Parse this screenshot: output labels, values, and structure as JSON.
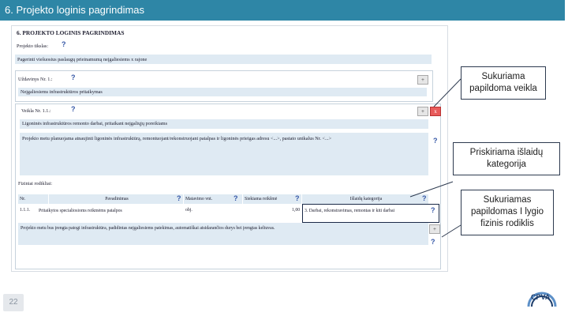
{
  "slide": {
    "title": "6. Projekto loginis pagrindimas",
    "page_number": "22"
  },
  "form": {
    "title": "6. PROJEKTO LOGINIS PAGRINDIMAS",
    "goal_label": "Projekto tikslas:",
    "goal_value": "Pagerinti viešuosius paslaugų prieinamumą neįgaliesiems x rajone",
    "task_label": "Uždavinys Nr. 1.:",
    "task_value": "Neįgaliesiems infrastruktūros pritaikymas",
    "activity_label": "Veikla Nr. 1.1.:",
    "activity_value": "Ligoninės infrastruktūros remonto darbai, pritaikant neįgaliųjų poreikiams",
    "activity_desc": "Projekto metu planuojama atnaujinti ligoninės infrastruktūrą, remontuojant/rekonstruojant patalpas ir ligoninės prieigas adresu <...>, pastato unikalus Nr. <...>",
    "indicators_label": "Fiziniai rodikliai:",
    "table_headers": [
      "Nr.",
      "Pavadinimas",
      "Matavimo vnt.",
      "Siekiama reikšmė",
      "Išlaidų kategorija"
    ],
    "table_row": [
      "1.1.1.",
      "Pritaikytos specialiosioms reikmėms patalpos",
      "obj.",
      "1,00",
      "3. Darbai, rekonstravimas, remontas ir kiti darbai"
    ],
    "indicator_desc": "Projekto metu bus įrengta patogi infrastruktūra, padidintas neįgaliesiems patekimas, automatiškai atsidarančios durys bei įrengtas keltuvas.",
    "help_mark": "?",
    "button_add": "+",
    "button_remove": "x"
  },
  "callouts": {
    "create_activity": [
      "Sukuriama",
      "papildoma veikla"
    ],
    "cost_category": [
      "Priskiriama išlaidų",
      "kategorija"
    ],
    "create_indicator": [
      "Sukuriamas",
      "papildomas I lygio",
      "fizinis rodiklis"
    ]
  },
  "logo": {
    "text": "CPVA"
  },
  "colors": {
    "header": "#2e86a6",
    "field_bg": "#dfeaf3",
    "remove_button": "#e85b5b"
  }
}
